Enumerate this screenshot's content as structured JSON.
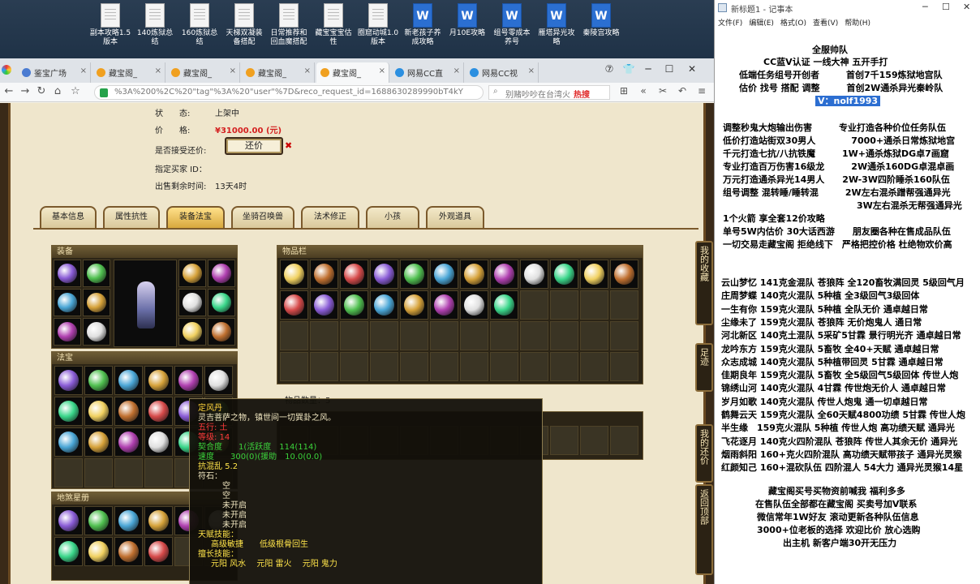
{
  "desktop": {
    "icons": [
      {
        "label": "副本攻略1.5版本",
        "type": "doc"
      },
      {
        "label": "140炼狱总结",
        "type": "doc"
      },
      {
        "label": "160炼狱总结",
        "type": "doc"
      },
      {
        "label": "天梯双凝装备搭配",
        "type": "doc"
      },
      {
        "label": "日常推荐和回血魔搭配",
        "type": "doc"
      },
      {
        "label": "藏宝宝宝估性",
        "type": "doc"
      },
      {
        "label": "圈窟动城1.0版本",
        "type": "doc"
      },
      {
        "label": "新老孩子养成攻略",
        "type": "word"
      },
      {
        "label": "月10E攻略",
        "type": "word"
      },
      {
        "label": "组号零成本养号",
        "type": "word"
      },
      {
        "label": "雁塔异光攻略",
        "type": "word"
      },
      {
        "label": "秦陵宫攻略",
        "type": "word"
      }
    ]
  },
  "browser": {
    "tabs": [
      {
        "label": "鉴宝广场",
        "active": false,
        "color": "#4a7bd1"
      },
      {
        "label": "藏宝阁_",
        "active": false,
        "color": "#f0a020"
      },
      {
        "label": "藏宝阁_",
        "active": false,
        "color": "#f0a020"
      },
      {
        "label": "藏宝阁_",
        "active": false,
        "color": "#f0a020"
      },
      {
        "label": "藏宝阁_",
        "active": true,
        "color": "#f0a020"
      },
      {
        "label": "网易CC直",
        "active": false,
        "color": "#2b8fe0"
      },
      {
        "label": "网易CC视",
        "active": false,
        "color": "#2b8fe0"
      }
    ],
    "url": "%3A%200%2C%20\"tag\"%3A%20\"user\"%7D&reco_request_id=1688630289990bT4kY",
    "search_text": "别赌吵吵在台湾火",
    "search_hot": "热搜"
  },
  "item_info": {
    "status_label": "状　　态:",
    "status_value": "上架中",
    "price_label": "价　　格:",
    "price_value": "¥31000.00 (元)",
    "counter_label": "是否接受还价:",
    "counter_button": "还价",
    "counter_x": "✖",
    "buyer_label": "指定买家 ID：",
    "remaining_label": "出售剩余时间:",
    "remaining_value": "13天4时"
  },
  "game_tabs": [
    {
      "label": "基本信息",
      "active": false
    },
    {
      "label": "属性抗性",
      "active": false
    },
    {
      "label": "装备法宝",
      "active": true
    },
    {
      "label": "坐骑召唤兽",
      "active": false
    },
    {
      "label": "法术修正",
      "active": false
    },
    {
      "label": "小孩",
      "active": false
    },
    {
      "label": "外观道具",
      "active": false
    }
  ],
  "panels": {
    "equipment_title": "装备",
    "fabao_title": "法宝",
    "dilao_title": "地煞星册",
    "items_title": "物品栏",
    "items_count_label": "物品数量：5"
  },
  "tooltip": {
    "name": "定风丹",
    "desc": "灵吉菩萨之物，镇世间一切巽卦之风。",
    "line_a": "五行: 土",
    "line_b": "等级: 14",
    "stat1": "契合度　　1(活跃度　114(114)",
    "stat2": "速度　　300(0)(援助　10.0(0.0)",
    "stat3": "抗混乱 5.2",
    "fushi": "符石：",
    "slot1": "空",
    "slot2": "空",
    "slot3": "未开启",
    "slot4": "未开启",
    "slot5": "未开启",
    "talent_title": "天赋技能：",
    "talent_line": "高级敏捷　　低级根骨回生",
    "skill_title": "擅长技能：",
    "skill_line": "元阳 风水　 元阳 雷火　 元阳 鬼力"
  },
  "side_buttons": [
    {
      "label": "我的收藏"
    },
    {
      "label": "足迹"
    },
    {
      "label": "我的还价"
    },
    {
      "label": "返回顶部"
    }
  ],
  "notepad": {
    "title": "新标题1 - 记事本",
    "menu": [
      "文件(F)",
      "编辑(E)",
      "格式(O)",
      "查看(V)",
      "帮助(H)"
    ],
    "header_lines": [
      "全服帅队",
      "CC蓝V认证 一线大神 五开手打",
      "低端任务组号开创者　　　首创7千159炼狱地宫队",
      "估价 找号 搭配 调整　　　首创2W通杀异光秦岭队"
    ],
    "vid": "V：nolf1993",
    "services": [
      "调整秒鬼大炮输出伤害　　　专业打造各种价位任务队伍",
      "低价打造站街双30男人　　　　7000+通杀日常炼狱地宫",
      "千元打造七抗/八抗铁魔　　　1W+通杀炼狱DG卓7画窟",
      "专业打造百万伤害16级龙　　　2W通杀160DG卓混卓画",
      "万元打造通杀异光14男人　　2W-3W四阶睡杀160队伍",
      "组号调整 混转睡/睡转混　　　2W左右混杀蹭帮强通异光",
      "　　　　　　　　　　　　　　　3W左右混杀无帮强通异光"
    ],
    "promo": [
      "1个火箭 享全套12价攻略",
      "单号5W内估价 30大话西游　　朋友圈各种在售成品队伍",
      "一切交易走藏宝阁 拒绝线下　严格把控价格 杜绝物欢价高"
    ],
    "teams": [
      "云山梦忆 141克金混队 苍狼阵 全120畜牧满回灵 5级回气月",
      "庄周梦蝶 140克火混队 5种植 全3级回气3级回体",
      "一生有你 159克火混队 5种植 全队无价 通卓越日常",
      "尘缘未了 159克火混队 苍狼阵 无价炮鬼人 通日常",
      "河北新区 140克土混队 5采矿5甘霖 景行明光齐 通卓越日常",
      "龙吟东方 159克火混队 5畜牧 全40+天赋 通卓越日常",
      "众志成城 140克火混队 5种植带回灵 5甘霖 通卓越日常",
      "佳期良年 159克火混队 5畜牧 全5级回气5级回体 传世人炮",
      "锦绣山河 140克火混队 4甘霖 传世炮无价人 通卓越日常",
      "岁月如歌 140克火混队 传世人炮鬼 通一切卓越日常",
      "鹤舞云天 159克火混队 全60天赋4800功绩 5甘霖 传世人炮",
      "半生缘　159克火混队 5种植 传世人炮 高功绩天赋 通异光",
      "飞花逐月 140克火四阶混队 苍狼阵 传世人其余无价 通异光",
      "烟雨斜阳 160+克火四阶混队 高功绩天赋带孩子 通异光灵猴",
      "红颜知己 160+混砍队伍 四阶混人 54大力 通异光灵猴14星"
    ],
    "footer": [
      "藏宝阁买号买物资前喊我 福利多多",
      "在售队伍全部都在藏宝阁 买卖号加V联系",
      "微信常年1W好友 滚动更新各种队伍信息",
      "3000+位老板的选择 欢迎比价 放心选购",
      "出主机 新客户端30开无压力"
    ]
  },
  "colors": {
    "price": "#d41f1f",
    "selection": "#2c6ed1",
    "tooltip_name": "#ffd43b",
    "tooltip_red": "#ff3b3b",
    "tooltip_green": "#3bd23b"
  }
}
